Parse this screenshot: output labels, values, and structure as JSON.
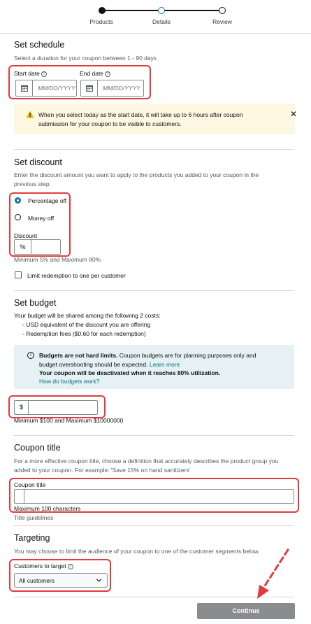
{
  "stepper": {
    "steps": [
      "Products",
      "Details",
      "Review"
    ]
  },
  "schedule": {
    "heading": "Set schedule",
    "description": "Select a duration for your coupon between 1 - 90 days",
    "start_label": "Start date",
    "end_label": "End date",
    "start_placeholder": "MM/DD/YYYY",
    "end_placeholder": "MM/DD/YYYY",
    "alert": "When you select today as the start date, it will take up to 6 hours after coupon submission for your coupon to be visible to customers.",
    "alert_close": "✕"
  },
  "discount": {
    "heading": "Set discount",
    "description_line1": "Enter the discount amount you want to apply to the products you added to your coupon in the",
    "description_line2": "previous step.",
    "options": [
      "Percentage off",
      "Money off"
    ],
    "selected": "Percentage off",
    "field_label": "Discount",
    "prefix": "%",
    "value": "",
    "hint": "Minimum 5% and Maximum 80%",
    "limit_label": "Limit redemption to one per customer",
    "limit_checked": false
  },
  "budget": {
    "heading": "Set budget",
    "description": "Your budget will be shared among the following 2 costs:",
    "costs": [
      "- USD equivalent of the discount you are offering",
      "- Redemption fees ($0.60 for each redemption)"
    ],
    "info_bold": "Budgets are not hard limits.",
    "info_text": "Coupon budgets are for planning purposes only and",
    "info_line2": "budget overshooting should be expected.",
    "info_link": "Learn more",
    "info_bold2": "Your coupon will be deactivated when it reaches 80% utilization.",
    "info_link2": "How do budgets work?",
    "prefix": "$",
    "value": "",
    "hint": "Minimum $100 and Maximum $10000000"
  },
  "title": {
    "heading": "Coupon title",
    "description_line1": "For a more effective coupon title, choose a definition that accurately describes the product group you",
    "description_line2": "added to your coupon. For example: 'Save 15% on hand sanitizers'",
    "field_label": "Coupon title",
    "value": "",
    "hint": "Maximum 100 characters",
    "guidelines": "Title guidelines"
  },
  "targeting": {
    "heading": "Targeting",
    "description": "You may choose to limit the audience of your coupon to one of the customer segments below.",
    "field_label": "Customers to target",
    "selected": "All customers"
  },
  "footer": {
    "continue_label": "Continue"
  },
  "colors": {
    "annotation": "#e23b3b",
    "accent": "#067d9a",
    "alert_bg": "#fef7e1",
    "info_bg": "#e5f1f2",
    "button_disabled": "#8a8d8d"
  }
}
